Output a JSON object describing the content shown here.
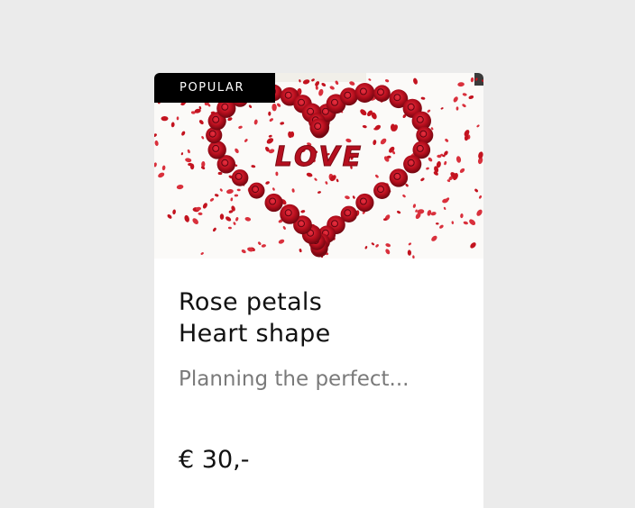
{
  "product_card": {
    "badge": "POPULAR",
    "image_caption": "LOVE",
    "title_line1": "Rose petals",
    "title_line2": "Heart shape",
    "description": "Planning the perfect...",
    "price": "€ 30,-"
  },
  "colors": {
    "page_background": "#ebebeb",
    "card_background": "#ffffff",
    "badge_background": "#000000",
    "rose_red": "#c0101e",
    "muted_text": "#7a7a7a"
  }
}
